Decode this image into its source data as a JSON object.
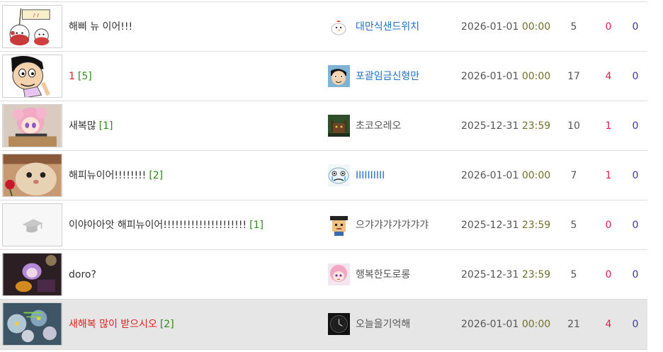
{
  "posts": [
    {
      "title": "해삐 뉴 이어!!!",
      "title_color": "normal",
      "comments": "",
      "author": "대만식샌드위치",
      "author_style": "link",
      "date": "2026-01-01",
      "time": "00:00",
      "views": "5",
      "likes": "0",
      "dislikes": "0",
      "thumb_icon": "happy-2026-cartoon-thumbnail",
      "avatar_icon": "chick-avatar-icon",
      "text_prefix": "",
      "highlighted": false
    },
    {
      "title": "1",
      "title_color": "red",
      "comments": "[5]",
      "author": "포괄임금신형만",
      "author_style": "link",
      "date": "2026-01-01",
      "time": "00:00",
      "views": "17",
      "likes": "4",
      "dislikes": "0",
      "thumb_icon": "cartoon-man-thumbnail",
      "avatar_icon": "cartoon-man-avatar-icon",
      "text_prefix": "",
      "highlighted": false
    },
    {
      "title": "새복많",
      "title_color": "normal",
      "comments": "[1]",
      "author": "초코오레오",
      "author_style": "normal",
      "date": "2025-12-31",
      "time": "23:59",
      "views": "10",
      "likes": "1",
      "dislikes": "0",
      "thumb_icon": "anime-girl-thumbnail",
      "avatar_icon": "cat-avatar-icon",
      "text_prefix": "",
      "highlighted": false
    },
    {
      "title": "해피뉴이어!!!!!!!!",
      "title_color": "normal",
      "comments": "[2]",
      "author": "IIIIIIIIII",
      "author_style": "link",
      "date": "2026-01-01",
      "time": "00:00",
      "views": "7",
      "likes": "1",
      "dislikes": "0",
      "thumb_icon": "cat-with-rose-thumbnail",
      "avatar_icon": "crying-face-avatar-icon",
      "text_prefix": "",
      "highlighted": false
    },
    {
      "title": "이야아아앗 해피뉴이어!!!!!!!!!!!!!!!!!!!!!",
      "title_color": "normal",
      "comments": "[1]",
      "author": "으갸갸갸갸갸갸갸",
      "author_style": "normal",
      "date": "2025-12-31",
      "time": "23:59",
      "views": "5",
      "likes": "0",
      "dislikes": "0",
      "thumb_icon": "graduation-cap-placeholder-icon",
      "avatar_icon": "pixel-graduate-avatar-icon",
      "text_prefix": "",
      "highlighted": false
    },
    {
      "title": "doro?",
      "title_color": "normal",
      "comments": "",
      "author": "행복한도로롱",
      "author_style": "normal",
      "date": "2025-12-31",
      "time": "23:59",
      "views": "5",
      "likes": "0",
      "dislikes": "0",
      "thumb_icon": "dark-anime-thumbnail",
      "avatar_icon": "pink-hair-avatar-icon",
      "text_prefix": "",
      "highlighted": false
    },
    {
      "title": "새해복 많이 받으시오",
      "title_color": "red",
      "comments": "[2]",
      "author": "오늘을기억해",
      "author_style": "normal",
      "date": "2026-01-01",
      "time": "00:00",
      "views": "21",
      "likes": "4",
      "dislikes": "0",
      "thumb_icon": "new-year-flowers-thumbnail",
      "avatar_icon": "dark-clock-avatar-icon",
      "text_prefix": "",
      "highlighted": true
    }
  ],
  "colors": {
    "title_red": "#e0201e",
    "comment_green": "#2e8b1a",
    "author_link": "#1f6fc6",
    "time_olive": "#6f6f2a",
    "likes_red": "#e0204e",
    "dislikes_blue": "#3d36b8",
    "highlight_bg": "#e6e6e6"
  }
}
